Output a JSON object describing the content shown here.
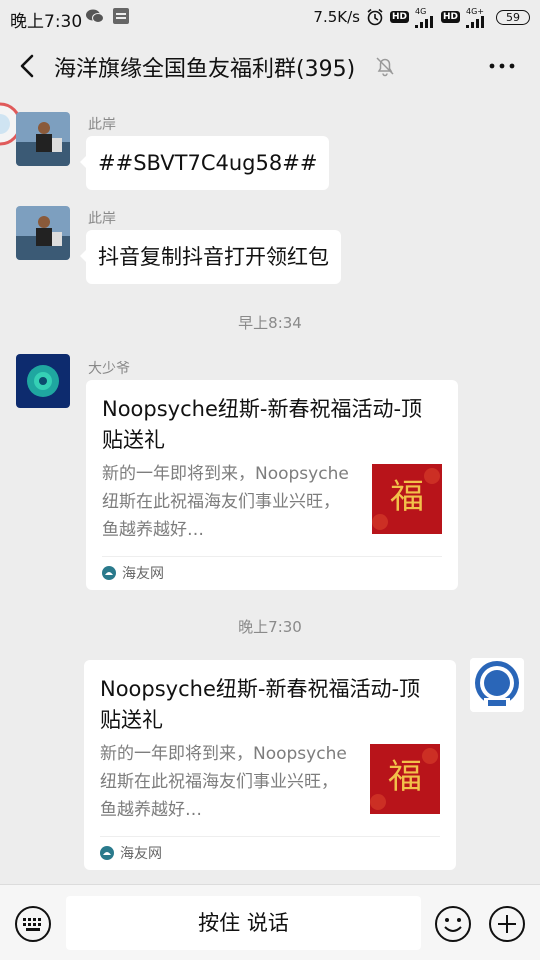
{
  "status_bar": {
    "time": "晚上7:30",
    "speed": "7.5K/s",
    "battery": "59",
    "net1": "4G",
    "net2": "4G+"
  },
  "header": {
    "title": "海洋旗缘全国鱼友福利群(395)"
  },
  "messages": [
    {
      "sender": "此岸",
      "text": "##SBVT7C4ug58##"
    },
    {
      "sender": "此岸",
      "text": "抖音复制抖音打开领红包"
    }
  ],
  "timestamps": [
    "早上8:34",
    "晚上7:30"
  ],
  "cards": [
    {
      "sender": "大少爷",
      "title": "Noopsyche纽斯-新春祝福活动-顶贴送礼",
      "desc": "新的一年即将到来，Noopsyche纽斯在此祝福海友们事业兴旺，鱼越养越好…",
      "source": "海友网",
      "thumb_glyph": "福"
    },
    {
      "sender": "",
      "title": "Noopsyche纽斯-新春祝福活动-顶贴送礼",
      "desc": "新的一年即将到来，Noopsyche纽斯在此祝福海友们事业兴旺，鱼越养越好…",
      "source": "海友网",
      "thumb_glyph": "福"
    }
  ],
  "input_bar": {
    "hold_to_talk": "按住 说话"
  },
  "colors": {
    "background": "#ededed",
    "bubble": "#ffffff",
    "thumb_red": "#b8141a",
    "gold": "#f2c14a"
  }
}
